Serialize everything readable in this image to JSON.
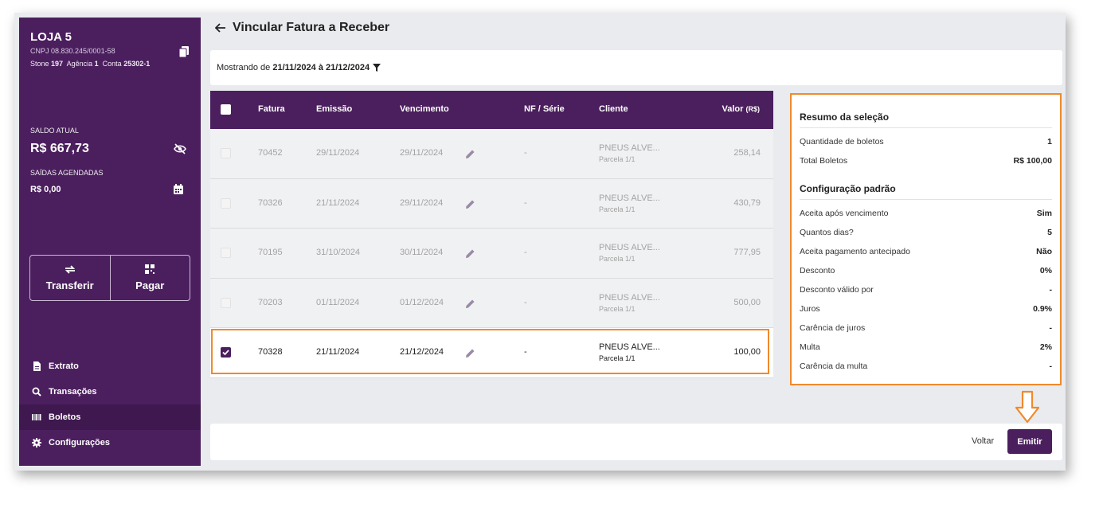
{
  "store": {
    "name": "LOJA 5",
    "cnpj": "CNPJ 08.830.245/0001-58",
    "bank_label": "Stone",
    "bank_value": "197",
    "agencia_label": "Agência",
    "agencia_value": "1",
    "conta_label": "Conta",
    "conta_value": "25302-1"
  },
  "balance": {
    "saldo_label": "SALDO ATUAL",
    "saldo_value": "R$ 667,73",
    "saidas_label": "SAÍDAS AGENDADAS",
    "saidas_value": "R$ 0,00"
  },
  "actions": {
    "transferir": "Transferir",
    "pagar": "Pagar"
  },
  "nav": [
    {
      "label": "Extrato",
      "icon": "document-icon"
    },
    {
      "label": "Transações",
      "icon": "search-icon"
    },
    {
      "label": "Boletos",
      "icon": "barcode-icon"
    },
    {
      "label": "Configurações",
      "icon": "gear-icon"
    }
  ],
  "header": {
    "title": "Vincular Fatura a Receber"
  },
  "filter": {
    "prefix": "Mostrando de",
    "range": "21/11/2024 à 21/12/2024"
  },
  "table": {
    "columns": {
      "fatura": "Fatura",
      "emissao": "Emissão",
      "vencimento": "Vencimento",
      "nf": "NF / Série",
      "cliente": "Cliente",
      "valor": "Valor",
      "valor_unit": "(R$)"
    },
    "rows": [
      {
        "fatura": "70452",
        "emissao": "29/11/2024",
        "vencimento": "29/11/2024",
        "nf": "-",
        "cliente": "PNEUS ALVE...",
        "parcela": "Parcela 1/1",
        "valor": "258,14",
        "selected": false
      },
      {
        "fatura": "70326",
        "emissao": "21/11/2024",
        "vencimento": "29/11/2024",
        "nf": "-",
        "cliente": "PNEUS ALVE...",
        "parcela": "Parcela 1/1",
        "valor": "430,79",
        "selected": false
      },
      {
        "fatura": "70195",
        "emissao": "31/10/2024",
        "vencimento": "30/11/2024",
        "nf": "-",
        "cliente": "PNEUS ALVE...",
        "parcela": "Parcela 1/1",
        "valor": "777,95",
        "selected": false
      },
      {
        "fatura": "70203",
        "emissao": "01/11/2024",
        "vencimento": "01/12/2024",
        "nf": "-",
        "cliente": "PNEUS ALVE...",
        "parcela": "Parcela 1/1",
        "valor": "500,00",
        "selected": false
      },
      {
        "fatura": "70328",
        "emissao": "21/11/2024",
        "vencimento": "21/12/2024",
        "nf": "-",
        "cliente": "PNEUS ALVE...",
        "parcela": "Parcela 1/1",
        "valor": "100,00",
        "selected": true
      }
    ]
  },
  "summary": {
    "title": "Resumo da seleção",
    "items": [
      {
        "label": "Quantidade de boletos",
        "value": "1"
      },
      {
        "label": "Total Boletos",
        "value": "R$ 100,00"
      }
    ],
    "config_title": "Configuração padrão",
    "config": [
      {
        "label": "Aceita após vencimento",
        "value": "Sim"
      },
      {
        "label": "Quantos dias?",
        "value": "5"
      },
      {
        "label": "Aceita pagamento antecipado",
        "value": "Não"
      },
      {
        "label": "Desconto",
        "value": "0%"
      },
      {
        "label": "Desconto válido por",
        "value": "-"
      },
      {
        "label": "Juros",
        "value": "0.9%"
      },
      {
        "label": "Carência de juros",
        "value": "-"
      },
      {
        "label": "Multa",
        "value": "2%"
      },
      {
        "label": "Carência da multa",
        "value": "-"
      }
    ]
  },
  "footer": {
    "voltar": "Voltar",
    "emitir": "Emitir"
  },
  "colors": {
    "brand": "#4b1f5e",
    "highlight": "#f08a2c"
  }
}
